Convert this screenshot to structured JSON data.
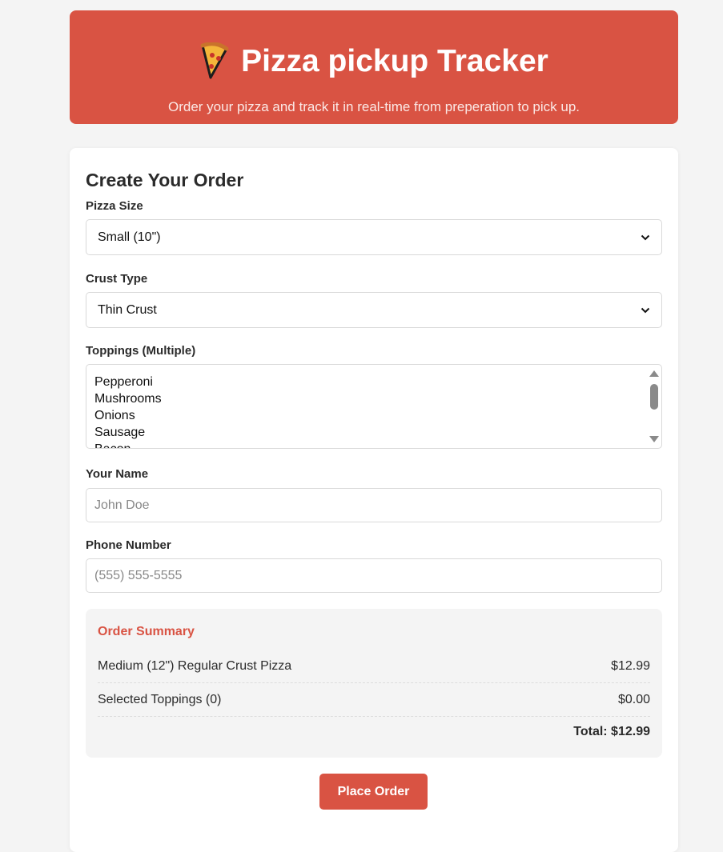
{
  "header": {
    "title": "Pizza pickup Tracker",
    "icon": "pizza-slice-icon",
    "subtitle": "Order your pizza and track it in real-time from preperation to pick up."
  },
  "order_form": {
    "title": "Create Your Order",
    "size": {
      "label": "Pizza Size",
      "selected": "Small (10\")"
    },
    "crust": {
      "label": "Crust Type",
      "selected": "Thin Crust"
    },
    "toppings": {
      "label": "Toppings (Multiple)",
      "options": [
        "Pepperoni",
        "Mushrooms",
        "Onions",
        "Sausage",
        "Bacon"
      ]
    },
    "name": {
      "label": "Your Name",
      "value": "",
      "placeholder": "John Doe"
    },
    "phone": {
      "label": "Phone Number",
      "value": "",
      "placeholder": "(555) 555-5555"
    }
  },
  "summary": {
    "title": "Order Summary",
    "rows": [
      {
        "label": "Medium (12\") Regular Crust Pizza",
        "price": "$12.99"
      },
      {
        "label": "Selected Toppings (0)",
        "price": "$0.00"
      }
    ],
    "total": "Total: $12.99"
  },
  "actions": {
    "place_order": "Place Order"
  },
  "colors": {
    "accent": "#d95343",
    "background": "#f4f4f4",
    "card": "#ffffff"
  }
}
